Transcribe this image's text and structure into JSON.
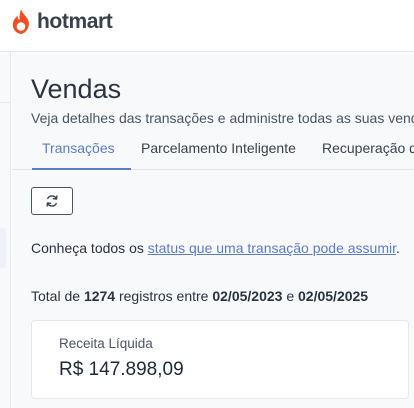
{
  "brand": {
    "name": "hotmart",
    "accent": "#f04e23"
  },
  "page": {
    "title": "Vendas",
    "subtitle": "Veja detalhes das transações e administre todas as suas vendas"
  },
  "tabs": [
    {
      "label": "Transações",
      "active": true
    },
    {
      "label": "Parcelamento Inteligente",
      "active": false
    },
    {
      "label": "Recuperação de",
      "active": false
    }
  ],
  "refresh": {
    "icon": "refresh-icon"
  },
  "status_info": {
    "prefix": "Conheça todos os",
    "link": "status que uma transação pode assumir",
    "suffix": "."
  },
  "total": {
    "prefix": "Total de",
    "count": "1274",
    "middle": "registros entre",
    "start_date": "02/05/2023",
    "connector": "e",
    "end_date": "02/05/2025"
  },
  "revenue_card": {
    "label": "Receita Líquida",
    "value": "R$ 147.898,09"
  },
  "colors": {
    "link": "#5b7bcc",
    "tab_active": "#5b7bcc",
    "background": "#f8f9fa"
  }
}
